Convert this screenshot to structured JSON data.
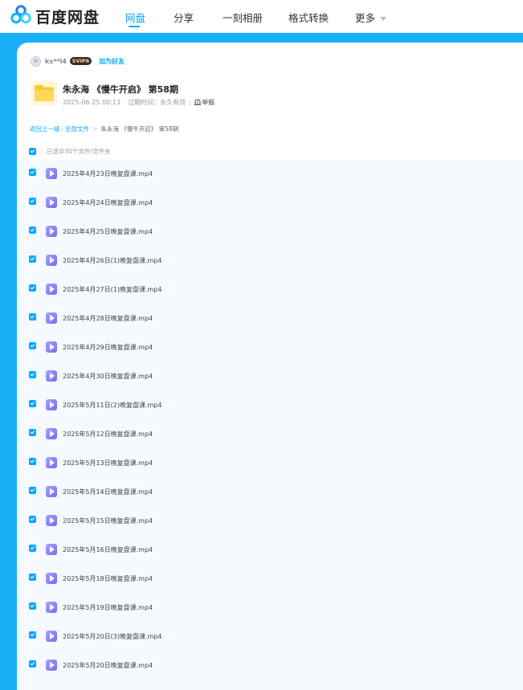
{
  "brand": {
    "name": "百度网盘",
    "colors": {
      "accent": "#06a7ff",
      "background": "#1ab0f8",
      "panel": "#ffffff",
      "list_bg": "#f4faff"
    }
  },
  "nav": {
    "items": [
      "网盘",
      "分享",
      "一刻相册",
      "格式转换",
      "更多"
    ],
    "active_index": 0
  },
  "owner": {
    "name": "ks**l4",
    "badge": "SVIP6",
    "add_friend": "加为好友"
  },
  "share": {
    "title": "朱永海 《慢牛开启》 第58期",
    "date": "2025-06-25 00:13",
    "expire": "过期时间：永久有效",
    "report": "举报"
  },
  "breadcrumb": {
    "back": "返回上一级",
    "all": "全部文件",
    "current": "朱永海 《慢牛开启》 第58期"
  },
  "selection": {
    "label": "已选中30个文件/文件夹"
  },
  "files": [
    "2025年4月23日晚复盘课.mp4",
    "2025年4月24日晚复盘课.mp4",
    "2025年4月25日晚复盘课.mp4",
    "2025年4月26日(1)晚复盘课.mp4",
    "2025年4月27日(1)晚复盘课.mp4",
    "2025年4月28日晚复盘课.mp4",
    "2025年4月29日晚复盘课.mp4",
    "2025年4月30日晚复盘课.mp4",
    "2025年5月11日(2)晚复盘课.mp4",
    "2025年5月12日晚复盘课.mp4",
    "2025年5月13日晚复盘课.mp4",
    "2025年5月14日晚复盘课.mp4",
    "2025年5月15日晚复盘课.mp4",
    "2025年5月16日晚复盘课.mp4",
    "2025年5月18日晚复盘课.mp4",
    "2025年5月19日晚复盘课.mp4",
    "2025年5月20日(3)晚复盘课.mp4",
    "2025年5月20日晚复盘课.mp4"
  ],
  "icons": {
    "logo": "baidu-netdisk-logo-icon",
    "folder": "folder-icon",
    "video": "video-file-icon",
    "check": "checkbox-checked-icon",
    "report": "warning-icon",
    "more": "chevron-down-icon"
  }
}
